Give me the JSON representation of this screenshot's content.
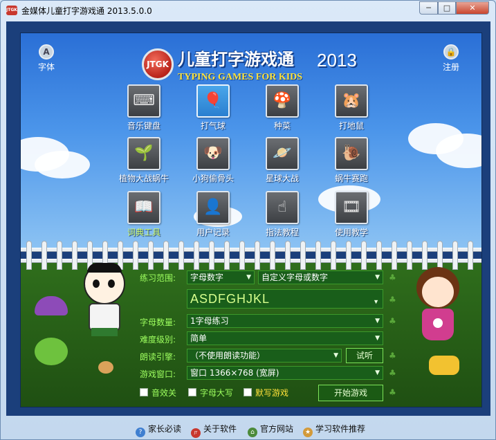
{
  "window": {
    "logo_text": "JTGK",
    "title": "金媒体儿童打字游戏通 2013.5.0.0",
    "minimize_glyph": "─",
    "maximize_glyph": "□",
    "close_glyph": "✕"
  },
  "header": {
    "logo_badge": "JTGK",
    "title": "儿童打字游戏通",
    "year": "2013",
    "subtitle": "TYPING GAMES FOR KIDS"
  },
  "corners": {
    "font": {
      "label": "字体",
      "icon": "font-icon",
      "glyph": "A"
    },
    "register": {
      "label": "注册",
      "icon": "lock-icon",
      "glyph": "🔒"
    }
  },
  "games": [
    {
      "label": "音乐键盘",
      "icon": "keyboard-icon",
      "glyph": "⌨",
      "selected": false,
      "highlight": false
    },
    {
      "label": "打气球",
      "icon": "balloon-icon",
      "glyph": "🎈",
      "selected": true,
      "highlight": false
    },
    {
      "label": "种菜",
      "icon": "mushroom-icon",
      "glyph": "🍄",
      "selected": false,
      "highlight": false
    },
    {
      "label": "打地鼠",
      "icon": "mole-icon",
      "glyph": "🐹",
      "selected": false,
      "highlight": false
    },
    {
      "label": "植物大战蜗牛",
      "icon": "plant-icon",
      "glyph": "🌱",
      "selected": false,
      "highlight": false
    },
    {
      "label": "小狗偷骨头",
      "icon": "dog-icon",
      "glyph": "🐶",
      "selected": false,
      "highlight": false
    },
    {
      "label": "星球大战",
      "icon": "planet-icon",
      "glyph": "🪐",
      "selected": false,
      "highlight": false
    },
    {
      "label": "蜗牛赛跑",
      "icon": "snail-icon",
      "glyph": "🐌",
      "selected": false,
      "highlight": false
    },
    {
      "label": "词典工具",
      "icon": "dictionary-icon",
      "glyph": "📖",
      "selected": false,
      "highlight": true
    },
    {
      "label": "用户记录",
      "icon": "user-record-icon",
      "glyph": "👤",
      "selected": false,
      "highlight": false
    },
    {
      "label": "指法教程",
      "icon": "fingering-icon",
      "glyph": "☝",
      "selected": false,
      "highlight": false
    },
    {
      "label": "使用教学",
      "icon": "film-reel-icon",
      "glyph": "🎞",
      "selected": false,
      "highlight": false
    }
  ],
  "form": {
    "range_label": "练习范围:",
    "range_value": "字母数字",
    "range_custom": "自定义字母或数字",
    "letters": "ASDFGHJKL",
    "count_label": "字母数量:",
    "count_value": "1字母练习",
    "level_label": "难度级别:",
    "level_value": "简单",
    "engine_label": "朗读引擎:",
    "engine_value": "（不使用朗读功能）",
    "listen_button": "试听",
    "window_label": "游戏窗口:",
    "window_value": "窗口 1366×768 (宽屏)",
    "checkboxes": [
      {
        "label": "音效关",
        "checked": false
      },
      {
        "label": "字母大写",
        "checked": false
      },
      {
        "label": "默写游戏",
        "checked": false
      }
    ],
    "start_button": "开始游戏",
    "accent": "#9eff5f"
  },
  "statusbar": {
    "items": [
      {
        "label": "家长必读",
        "icon": "help-icon"
      },
      {
        "label": "关于软件",
        "icon": "jtgk-logo-icon"
      },
      {
        "label": "官方网站",
        "icon": "home-icon"
      },
      {
        "label": "学习软件推荐",
        "icon": "recommend-icon"
      }
    ]
  }
}
